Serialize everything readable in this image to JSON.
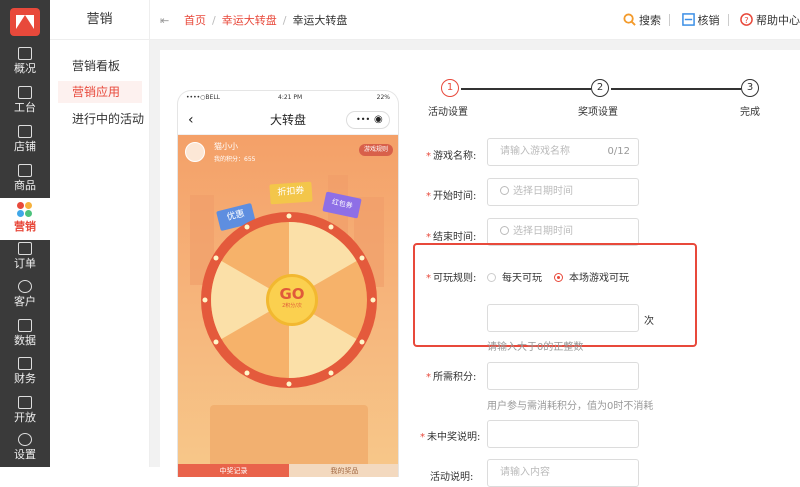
{
  "sidebar": {
    "items": [
      {
        "label": "概况",
        "icon": "dashboard-icon"
      },
      {
        "label": "工台",
        "icon": "monitor-icon"
      },
      {
        "label": "店铺",
        "icon": "store-icon"
      },
      {
        "label": "商品",
        "icon": "bag-icon"
      },
      {
        "label": "营销",
        "icon": "marketing-icon",
        "active": true
      },
      {
        "label": "订单",
        "icon": "order-icon"
      },
      {
        "label": "客户",
        "icon": "user-icon"
      },
      {
        "label": "数据",
        "icon": "chart-icon"
      },
      {
        "label": "财务",
        "icon": "finance-icon"
      },
      {
        "label": "开放",
        "icon": "code-icon"
      },
      {
        "label": "设置",
        "icon": "gear-icon"
      }
    ]
  },
  "subnav": {
    "title": "营销",
    "items": [
      {
        "label": "营销看板"
      },
      {
        "label": "营销应用",
        "active": true
      },
      {
        "label": "进行中的活动"
      }
    ]
  },
  "header": {
    "breadcrumb": [
      "首页",
      "幸运大转盘",
      "幸运大转盘"
    ],
    "actions": [
      "搜索",
      "核销",
      "帮助中心"
    ]
  },
  "phone": {
    "carrier": "BELL",
    "time": "4:21 PM",
    "battery": "22%",
    "page_title": "大转盘",
    "user_name": "猫小小",
    "points_text": "我的积分：655",
    "rules_button": "游戏规则",
    "tickets": [
      "优惠",
      "折扣券",
      "红包券"
    ],
    "go_label": "GO",
    "cost_label": "2积分/次",
    "tabs": [
      "中奖记录",
      "我的奖品"
    ]
  },
  "steps": [
    {
      "num": "1",
      "label": "活动设置",
      "active": true
    },
    {
      "num": "2",
      "label": "奖项设置"
    },
    {
      "num": "3",
      "label": "完成"
    }
  ],
  "form": {
    "game_name": {
      "label": "游戏名称:",
      "placeholder": "请输入游戏名称",
      "counter": "0/12"
    },
    "start_time": {
      "label": "开始时间:",
      "placeholder": "选择日期时间"
    },
    "end_time": {
      "label": "结束时间:",
      "placeholder": "选择日期时间"
    },
    "play_rule": {
      "label": "可玩规则:",
      "options": [
        "每天可玩",
        "本场游戏可玩"
      ],
      "selected": 1,
      "unit": "次",
      "hint": "请输入大于0的正整数"
    },
    "points_required": {
      "label": "所需积分:",
      "hint": "用户参与需消耗积分，值为0时不消耗"
    },
    "no_win_desc": {
      "label": "未中奖说明:"
    },
    "activity_desc": {
      "label": "活动说明:",
      "placeholder": "请输入内容"
    }
  },
  "colors": {
    "accent": "#e8493b",
    "sidebar_bg": "#3a3a3a"
  }
}
